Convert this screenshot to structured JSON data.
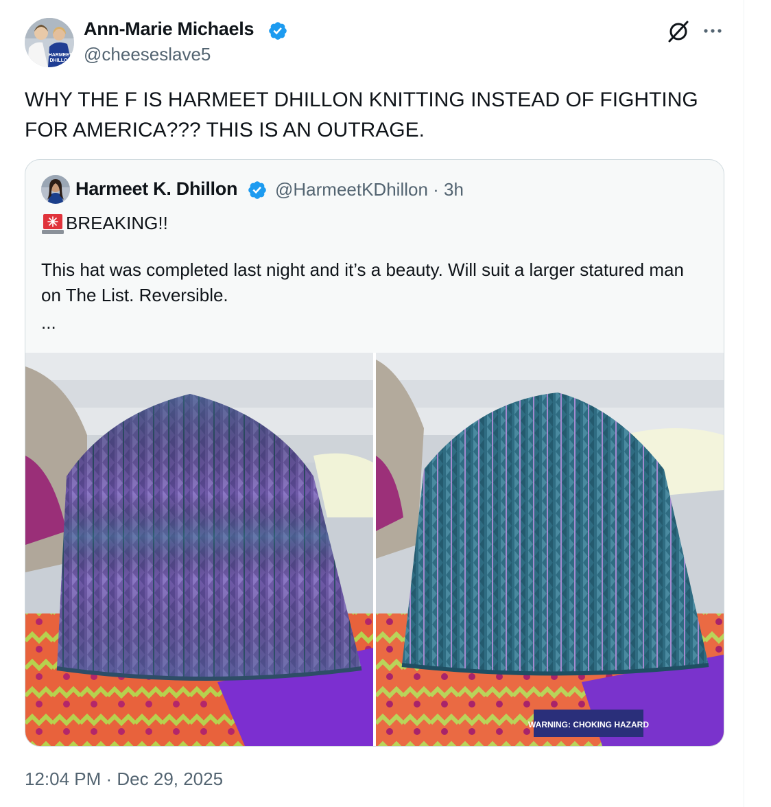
{
  "tweet": {
    "author_name": "Ann-Marie Michaels",
    "author_handle": "@cheeseslave5",
    "text": "WHY THE F IS HARMEET DHILLON KNITTING INSTEAD OF FIGHTING FOR AMERICA??? THIS IS AN OUTRAGE.",
    "timestamp": "12:04 PM · Dec 29, 2025",
    "verified_color": "#1d9bf0"
  },
  "avatar_text": {
    "line1": "HARMEET",
    "line2": "DHILLON"
  },
  "quote": {
    "author_name": "Harmeet K. Dhillon",
    "handle_and_time": "@HarmeetKDhillon · 3h",
    "breaking_label": "BREAKING!!",
    "body": "This hat was completed last night and it’s a beauty. Will suit a larger statured man on The List. Reversible.",
    "ellipsis": "...",
    "photo_left_alt_label": "",
    "photo_right_tag": "WARNING: CHOKING HAZARD"
  },
  "icons": {
    "grok": "grok-icon",
    "more": "more-icon",
    "siren": "siren-icon",
    "verified": "verified-badge-icon"
  }
}
